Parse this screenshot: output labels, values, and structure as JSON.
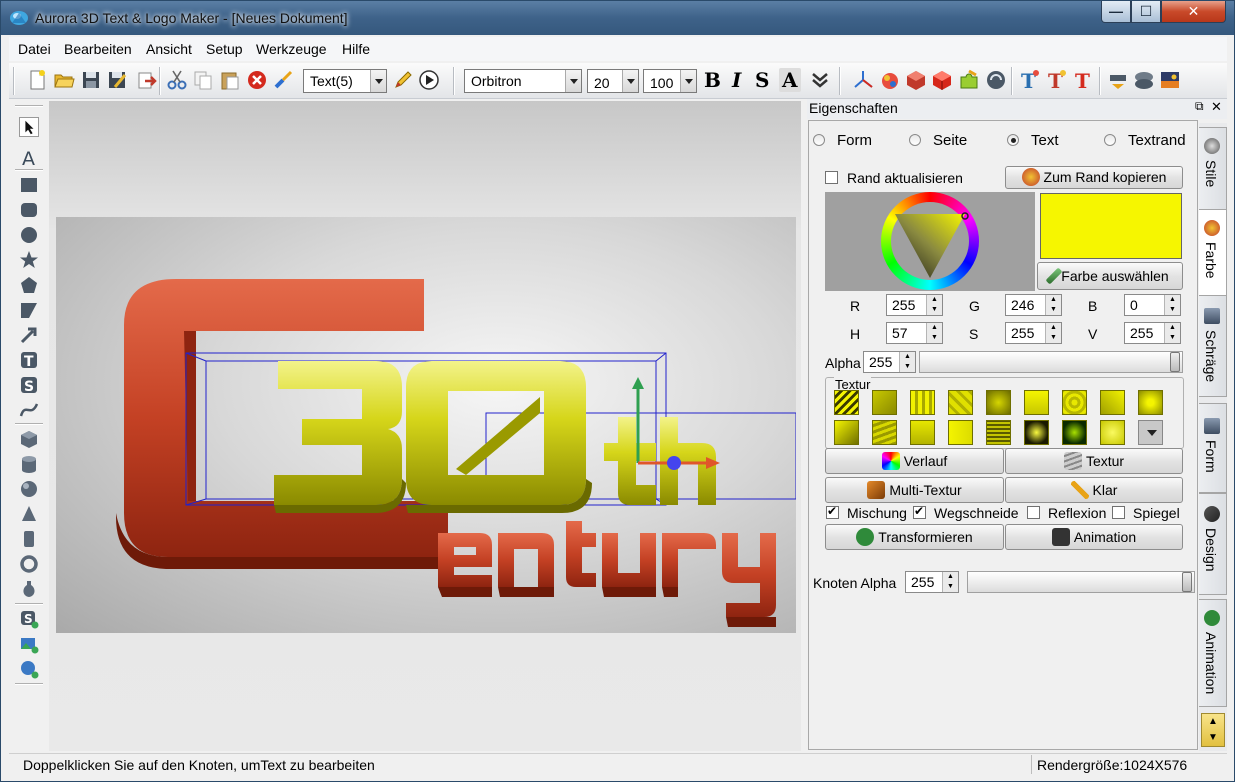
{
  "window": {
    "title": "Aurora 3D Text & Logo Maker - [Neues Dokument]",
    "controls": {
      "minimize": "—",
      "maximize": "☐",
      "close": "✕"
    }
  },
  "menu": [
    "Datei",
    "Bearbeiten",
    "Ansicht",
    "Setup",
    "Werkzeuge",
    "Hilfe"
  ],
  "toolbar": {
    "text_select": "Text(5)",
    "font": "Orbitron",
    "font_size": "20",
    "scale": "100",
    "bold": "B",
    "italic": "I",
    "strike": "S",
    "shadow": "A"
  },
  "scene": {
    "lines": [
      "30th",
      "entury"
    ],
    "accent_text": "#d4d40a",
    "accent_bracket": "#c94a2e"
  },
  "panel": {
    "header": "Eigenschaften",
    "modes": [
      {
        "label": "Form",
        "selected": false
      },
      {
        "label": "Seite",
        "selected": false
      },
      {
        "label": "Text",
        "selected": true
      },
      {
        "label": "Textrand",
        "selected": false
      }
    ],
    "rand_aktualisieren": "Rand aktualisieren",
    "zum_rand": "Zum Rand kopieren",
    "farbe_auswaehlen": "Farbe auswählen",
    "color_swatch": "#f6f600",
    "rgb": {
      "r_label": "R",
      "r": "255",
      "g_label": "G",
      "g": "246",
      "b_label": "B",
      "b": "0"
    },
    "hsv": {
      "h_label": "H",
      "h": "57",
      "s_label": "S",
      "s": "255",
      "v_label": "V",
      "v": "255"
    },
    "alpha_label": "Alpha",
    "alpha": "255",
    "textur_label": "Textur",
    "buttons": {
      "verlauf": "Verlauf",
      "textur": "Textur",
      "multi_textur": "Multi-Textur",
      "klar": "Klar",
      "transformieren": "Transformieren",
      "animation": "Animation"
    },
    "checks": [
      {
        "label": "Mischung",
        "checked": true
      },
      {
        "label": "Wegschneide",
        "checked": true
      },
      {
        "label": "Reflexion",
        "checked": false
      },
      {
        "label": "Spiegel",
        "checked": false
      }
    ],
    "knoten_alpha_label": "Knoten Alpha",
    "knoten_alpha": "255"
  },
  "vtabs": [
    "Stile",
    "Farbe",
    "Schräge",
    "Form",
    "Design",
    "Animation"
  ],
  "status": {
    "hint": "Doppelklicken Sie auf den Knoten, umText zu bearbeiten",
    "render_size": "Rendergröße:1024X576"
  }
}
